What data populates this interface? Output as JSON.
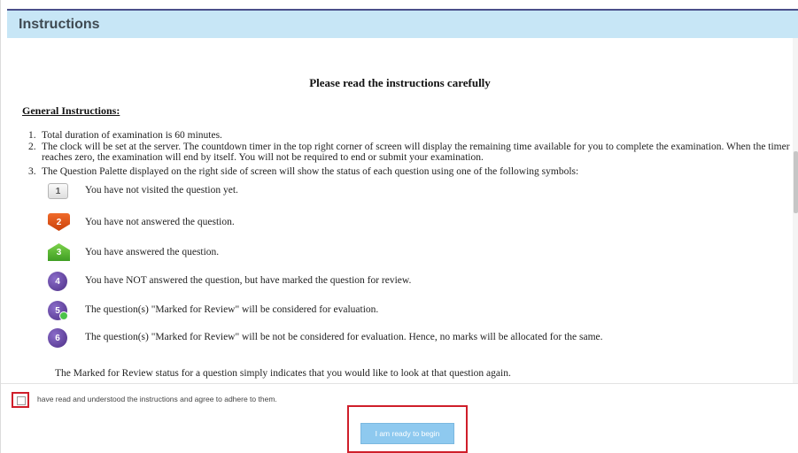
{
  "header": {
    "title": "Instructions"
  },
  "content": {
    "heading": "Please read the instructions carefully",
    "section_title": "General Instructions:",
    "instructions": [
      {
        "number": "1.",
        "text": "Total duration of examination is 60 minutes."
      },
      {
        "number": "2.",
        "text": "The clock will be set at the server. The countdown timer in the top right corner of screen will display the remaining time available for you to complete the examination. When the timer reaches zero, the examination will end by itself. You will not be required to end or submit your examination."
      },
      {
        "number": "3.",
        "text": "The Question Palette displayed on the right side of screen will show the status of each question using one of the following symbols:"
      }
    ],
    "symbols": [
      {
        "icon": "not-visited-icon",
        "badge": "1",
        "text": "You have not visited the question yet."
      },
      {
        "icon": "not-answered-icon",
        "badge": "2",
        "text": "You have not answered the question."
      },
      {
        "icon": "answered-icon",
        "badge": "3",
        "text": "You have answered the question."
      },
      {
        "icon": "marked-for-review-icon",
        "badge": "4",
        "text": "You have NOT answered the question, but have marked the question for review."
      },
      {
        "icon": "answered-marked-for-review-icon",
        "badge": "5",
        "text": "The question(s) \"Marked for Review\" will be considered for evaluation."
      },
      {
        "icon": "marked-not-evaluated-icon",
        "badge": "6",
        "text": "The question(s) \"Marked for Review\" will be not be considered for evaluation. Hence, no marks will be allocated for the same."
      }
    ],
    "footer_note": "The Marked for Review status for a question simply indicates that you would like to look at that question again."
  },
  "agreement": {
    "text": "have read and understood the instructions and agree to adhere to them.",
    "checked": false
  },
  "begin_button": {
    "label": "I am ready to begin"
  },
  "colors": {
    "header_bg": "#c7e6f6",
    "header_line": "#4a4f8a",
    "highlight": "#cf1e2a",
    "button_bg": "#8ec9ef",
    "not_answered": "#e2561b",
    "answered": "#5cb832",
    "marked": "#5b3a96"
  }
}
